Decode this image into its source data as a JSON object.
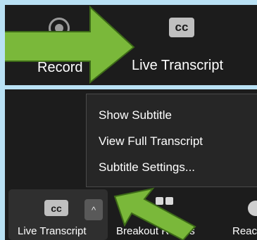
{
  "top_toolbar": {
    "record_label": "Record",
    "cc_badge": "cc",
    "live_transcript_label": "Live Transcript"
  },
  "menu": {
    "items": [
      {
        "label": "Show Subtitle"
      },
      {
        "label": "View Full Transcript"
      },
      {
        "label": "Subtitle Settings..."
      }
    ]
  },
  "bottom_toolbar": {
    "cc_badge": "cc",
    "caret": "^",
    "live_transcript_label": "Live Transcript",
    "breakout_rooms_label": "Breakout Rooms",
    "reactions_label": "Reactions"
  },
  "colors": {
    "background": "#b9e1f4",
    "panel": "#1c1c1c",
    "arrow_fill": "#7ab83a",
    "arrow_border": "#3d6a18"
  },
  "icons": [
    "record-icon",
    "cc-icon",
    "chevron-up-icon",
    "breakout-rooms-icon",
    "reactions-icon",
    "arrow-pointer"
  ]
}
